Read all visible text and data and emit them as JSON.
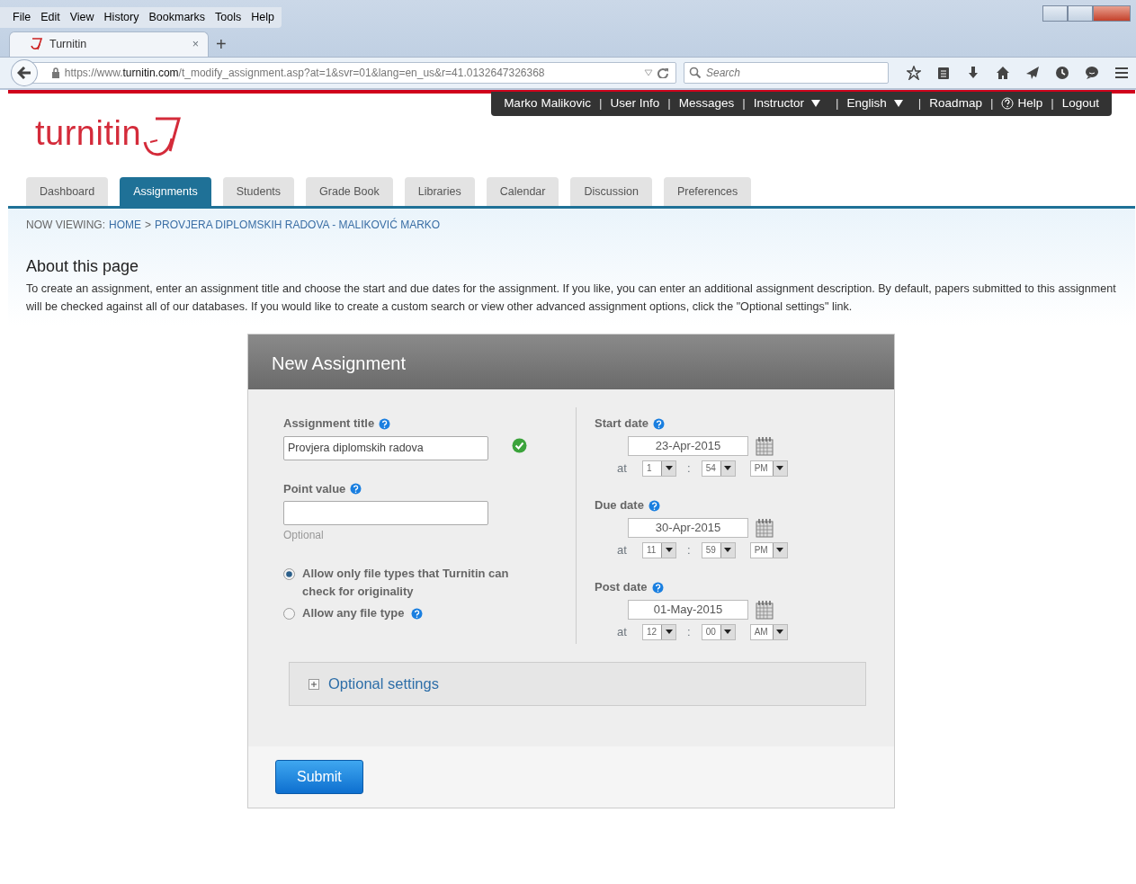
{
  "browser": {
    "menu": [
      "File",
      "Edit",
      "View",
      "History",
      "Bookmarks",
      "Tools",
      "Help"
    ],
    "tab": {
      "title": "Turnitin",
      "close": "×",
      "selected": true
    },
    "new_tab": "+",
    "url": {
      "host_prefix": "https://www.",
      "host": "turnitin.com",
      "path": "/t_modify_assignment.asp?at=1&svr=01&lang=en_us&r=41.0132647326368"
    },
    "search": {
      "placeholder": "Search"
    }
  },
  "top_links_separator": "|",
  "top_links": [
    {
      "label": "Marko Malikovic",
      "kind": "link"
    },
    {
      "label": "User Info",
      "kind": "link"
    },
    {
      "label": "Messages",
      "kind": "link"
    },
    {
      "label": "Instructor",
      "kind": "dropdown"
    },
    {
      "label": "English",
      "kind": "dropdown"
    },
    {
      "label": "Roadmap",
      "kind": "link"
    },
    {
      "label": "Help",
      "kind": "help"
    },
    {
      "label": "Logout",
      "kind": "link"
    }
  ],
  "logo": {
    "text": "turnitin"
  },
  "tabs": [
    {
      "label": "Dashboard",
      "selected": false
    },
    {
      "label": "Assignments",
      "selected": true
    },
    {
      "label": "Students",
      "selected": false
    },
    {
      "label": "Grade Book",
      "selected": false
    },
    {
      "label": "Libraries",
      "selected": false
    },
    {
      "label": "Calendar",
      "selected": false
    },
    {
      "label": "Discussion",
      "selected": false
    },
    {
      "label": "Preferences",
      "selected": false
    }
  ],
  "breadcrumb": {
    "prefix": "NOW VIEWING:",
    "items": [
      "HOME",
      "PROVJERA DIPLOMSKIH RADOVA - MALIKOVIĆ MARKO"
    ],
    "separator": ">"
  },
  "about": {
    "title": "About this page",
    "text": "To create an assignment, enter an assignment title and choose the start and due dates for the assignment. If you like, you can enter an additional assignment description. By default, papers submitted to this assignment will be checked against all of our databases. If you would like to create a custom search or view other advanced assignment options, click the \"Optional settings\" link."
  },
  "form": {
    "title": "New Assignment",
    "assignment_title": {
      "label": "Assignment title",
      "value": "Provjera diplomskih radova",
      "valid": true
    },
    "point_value": {
      "label": "Point value",
      "hint": "Optional"
    },
    "file_types": [
      {
        "label": "Allow only file types that Turnitin can check for originality",
        "selected": true,
        "help": false
      },
      {
        "label": "Allow any file type",
        "selected": false,
        "help": true
      }
    ],
    "dates": [
      {
        "label": "Start date",
        "date": "23-Apr-2015",
        "at": "at",
        "hour": "1",
        "colon": ":",
        "minute": "54",
        "ampm": "PM"
      },
      {
        "label": "Due date",
        "date": "30-Apr-2015",
        "at": "at",
        "hour": "11",
        "colon": ":",
        "minute": "59",
        "ampm": "PM"
      },
      {
        "label": "Post date",
        "date": "01-May-2015",
        "at": "at",
        "hour": "12",
        "colon": ":",
        "minute": "00",
        "ampm": "AM"
      }
    ],
    "optional_settings": {
      "label": "Optional settings",
      "expanded": false
    },
    "submit": "Submit"
  }
}
